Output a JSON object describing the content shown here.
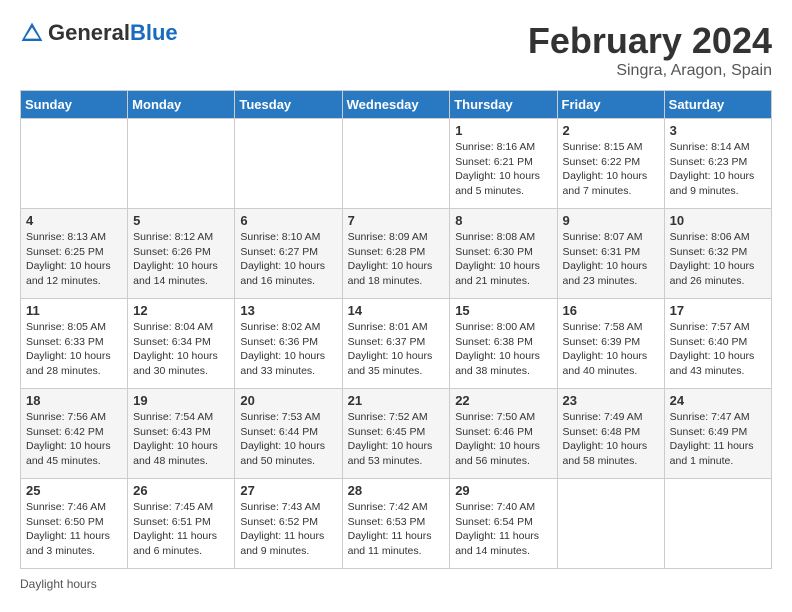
{
  "header": {
    "logo_general": "General",
    "logo_blue": "Blue",
    "month_title": "February 2024",
    "location": "Singra, Aragon, Spain"
  },
  "days_of_week": [
    "Sunday",
    "Monday",
    "Tuesday",
    "Wednesday",
    "Thursday",
    "Friday",
    "Saturday"
  ],
  "weeks": [
    [
      {
        "day": "",
        "info": ""
      },
      {
        "day": "",
        "info": ""
      },
      {
        "day": "",
        "info": ""
      },
      {
        "day": "",
        "info": ""
      },
      {
        "day": "1",
        "info": "Sunrise: 8:16 AM\nSunset: 6:21 PM\nDaylight: 10 hours and 5 minutes."
      },
      {
        "day": "2",
        "info": "Sunrise: 8:15 AM\nSunset: 6:22 PM\nDaylight: 10 hours and 7 minutes."
      },
      {
        "day": "3",
        "info": "Sunrise: 8:14 AM\nSunset: 6:23 PM\nDaylight: 10 hours and 9 minutes."
      }
    ],
    [
      {
        "day": "4",
        "info": "Sunrise: 8:13 AM\nSunset: 6:25 PM\nDaylight: 10 hours and 12 minutes."
      },
      {
        "day": "5",
        "info": "Sunrise: 8:12 AM\nSunset: 6:26 PM\nDaylight: 10 hours and 14 minutes."
      },
      {
        "day": "6",
        "info": "Sunrise: 8:10 AM\nSunset: 6:27 PM\nDaylight: 10 hours and 16 minutes."
      },
      {
        "day": "7",
        "info": "Sunrise: 8:09 AM\nSunset: 6:28 PM\nDaylight: 10 hours and 18 minutes."
      },
      {
        "day": "8",
        "info": "Sunrise: 8:08 AM\nSunset: 6:30 PM\nDaylight: 10 hours and 21 minutes."
      },
      {
        "day": "9",
        "info": "Sunrise: 8:07 AM\nSunset: 6:31 PM\nDaylight: 10 hours and 23 minutes."
      },
      {
        "day": "10",
        "info": "Sunrise: 8:06 AM\nSunset: 6:32 PM\nDaylight: 10 hours and 26 minutes."
      }
    ],
    [
      {
        "day": "11",
        "info": "Sunrise: 8:05 AM\nSunset: 6:33 PM\nDaylight: 10 hours and 28 minutes."
      },
      {
        "day": "12",
        "info": "Sunrise: 8:04 AM\nSunset: 6:34 PM\nDaylight: 10 hours and 30 minutes."
      },
      {
        "day": "13",
        "info": "Sunrise: 8:02 AM\nSunset: 6:36 PM\nDaylight: 10 hours and 33 minutes."
      },
      {
        "day": "14",
        "info": "Sunrise: 8:01 AM\nSunset: 6:37 PM\nDaylight: 10 hours and 35 minutes."
      },
      {
        "day": "15",
        "info": "Sunrise: 8:00 AM\nSunset: 6:38 PM\nDaylight: 10 hours and 38 minutes."
      },
      {
        "day": "16",
        "info": "Sunrise: 7:58 AM\nSunset: 6:39 PM\nDaylight: 10 hours and 40 minutes."
      },
      {
        "day": "17",
        "info": "Sunrise: 7:57 AM\nSunset: 6:40 PM\nDaylight: 10 hours and 43 minutes."
      }
    ],
    [
      {
        "day": "18",
        "info": "Sunrise: 7:56 AM\nSunset: 6:42 PM\nDaylight: 10 hours and 45 minutes."
      },
      {
        "day": "19",
        "info": "Sunrise: 7:54 AM\nSunset: 6:43 PM\nDaylight: 10 hours and 48 minutes."
      },
      {
        "day": "20",
        "info": "Sunrise: 7:53 AM\nSunset: 6:44 PM\nDaylight: 10 hours and 50 minutes."
      },
      {
        "day": "21",
        "info": "Sunrise: 7:52 AM\nSunset: 6:45 PM\nDaylight: 10 hours and 53 minutes."
      },
      {
        "day": "22",
        "info": "Sunrise: 7:50 AM\nSunset: 6:46 PM\nDaylight: 10 hours and 56 minutes."
      },
      {
        "day": "23",
        "info": "Sunrise: 7:49 AM\nSunset: 6:48 PM\nDaylight: 10 hours and 58 minutes."
      },
      {
        "day": "24",
        "info": "Sunrise: 7:47 AM\nSunset: 6:49 PM\nDaylight: 11 hours and 1 minute."
      }
    ],
    [
      {
        "day": "25",
        "info": "Sunrise: 7:46 AM\nSunset: 6:50 PM\nDaylight: 11 hours and 3 minutes."
      },
      {
        "day": "26",
        "info": "Sunrise: 7:45 AM\nSunset: 6:51 PM\nDaylight: 11 hours and 6 minutes."
      },
      {
        "day": "27",
        "info": "Sunrise: 7:43 AM\nSunset: 6:52 PM\nDaylight: 11 hours and 9 minutes."
      },
      {
        "day": "28",
        "info": "Sunrise: 7:42 AM\nSunset: 6:53 PM\nDaylight: 11 hours and 11 minutes."
      },
      {
        "day": "29",
        "info": "Sunrise: 7:40 AM\nSunset: 6:54 PM\nDaylight: 11 hours and 14 minutes."
      },
      {
        "day": "",
        "info": ""
      },
      {
        "day": "",
        "info": ""
      }
    ]
  ],
  "footer": {
    "daylight_label": "Daylight hours"
  }
}
